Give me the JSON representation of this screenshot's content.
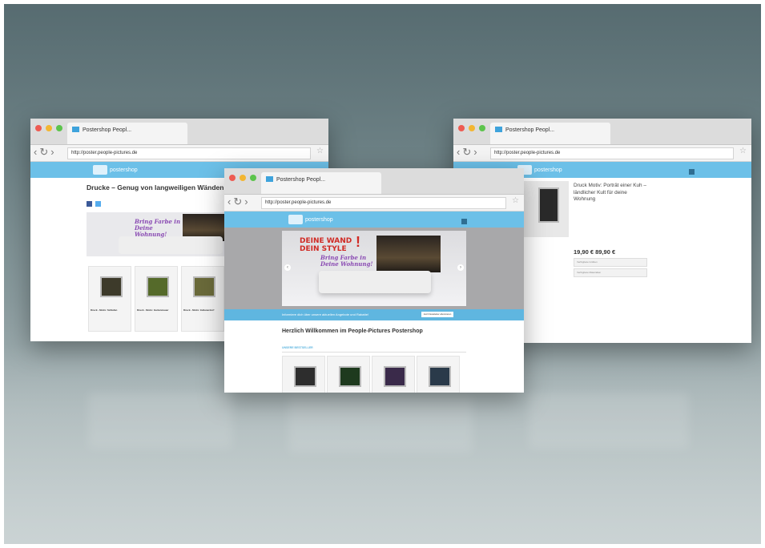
{
  "tab_title": "Postershop Peopl...",
  "address_url": "http://poster.people-pictures.de",
  "logo_text": "postershop",
  "left_window": {
    "page_title": "Drucke – Genug von langweiligen Wänden",
    "slogan": "Bring Farbe in Deine Wohnung!",
    "products": [
      "Druck - Motiv: Schlafen",
      "Druck - Motiv: Gartenmauer",
      "Druck - Motiv: Indianerdorf"
    ]
  },
  "center_window": {
    "banner_headline": "DEINE WAND DEIN STYLE",
    "banner_exclaim": "!",
    "banner_slogan": "Bring Farbe in Deine Wohnung!",
    "promo_text": "Informiere dich über unsere aktuellen Angebote und Rabatte!",
    "promo_button": "Jetzt Newsletter abonnieren",
    "welcome_title": "Herzlich Willkommen im People-Pictures Postershop",
    "bestseller_label": "UNSERE BESTSELLER"
  },
  "right_window": {
    "product_title": "Druck Motiv: Porträt einer Kuh – ländlicher Kult für deine Wohnung",
    "price": "19,90 € 89,90 €",
    "option_size_label": "Verfügbare Größen",
    "option_material_label": "Verfügbare Materialien"
  },
  "colors": {
    "accent": "#6cc0e8",
    "promo_bar": "#5fb6e0",
    "slogan": "#8a4bb3",
    "headline_red": "#d02a24"
  },
  "icons": [
    "back-arrow-icon",
    "reload-icon",
    "forward-arrow-icon",
    "bookmark-star-icon",
    "search-icon"
  ]
}
